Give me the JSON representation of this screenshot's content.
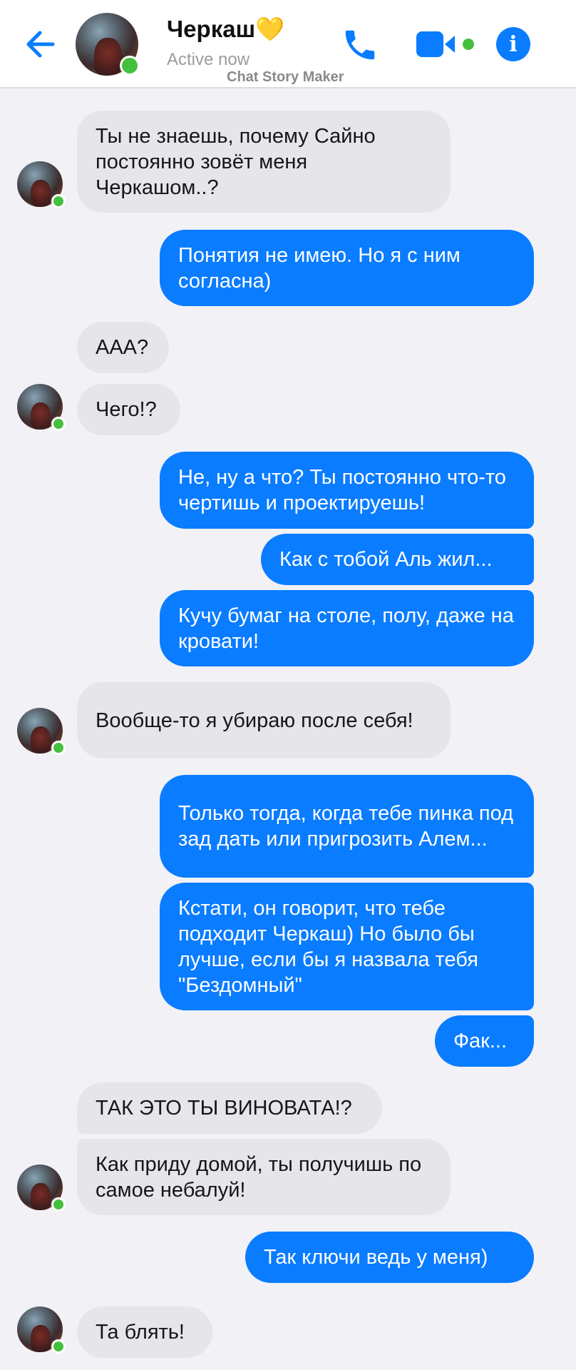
{
  "header": {
    "contact_name": "Черкаш💛",
    "status": "Active now",
    "watermark": "Chat Story Maker",
    "icons": [
      "back-arrow-icon",
      "phone-icon",
      "video-camera-icon",
      "info-icon"
    ],
    "accent_color": "#0a7cff",
    "online_color": "#44c13c"
  },
  "messages": [
    {
      "from": "contact",
      "text": "Ты не знаешь, почему Сайно постоянно зовёт меня Черкашом..?"
    },
    {
      "from": "me",
      "text": "Понятия не имею. Но я с ним согласна)"
    },
    {
      "from": "contact",
      "text": "ААА?"
    },
    {
      "from": "contact",
      "text": "Чего!?"
    },
    {
      "from": "me",
      "text": "Не, ну а что? Ты постоянно что-то чертишь и проектируешь!"
    },
    {
      "from": "me",
      "text": "Как с тобой Аль жил..."
    },
    {
      "from": "me",
      "text": "Кучу бумаг на столе, полу, даже на кровати!"
    },
    {
      "from": "contact",
      "text": "Вообще-то я убираю после себя!"
    },
    {
      "from": "me",
      "text": "Только тогда, когда тебе пинка под зад дать или пригрозить Алем..."
    },
    {
      "from": "me",
      "text": "Кстати, он говорит, что тебе подходит Черкаш) Но было бы лучше, если бы я назвала тебя \"Бездомный\""
    },
    {
      "from": "me",
      "text": "Фак..."
    },
    {
      "from": "contact",
      "text": "ТАК ЭТО ТЫ ВИНОВАТА!?"
    },
    {
      "from": "contact",
      "text": "Как приду домой, ты получишь по самое небалуй!"
    },
    {
      "from": "me",
      "text": "Так ключи ведь у меня)"
    },
    {
      "from": "contact",
      "text": "Та блять!"
    }
  ]
}
